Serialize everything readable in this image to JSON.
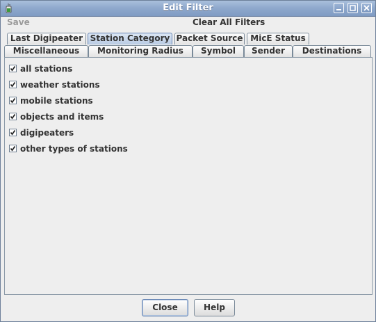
{
  "window": {
    "title": "Edit Filter"
  },
  "toolbar": {
    "save_label": "Save",
    "clear_label": "Clear All Filters"
  },
  "tabs": {
    "row1": [
      "Last Digipeater",
      "Station Category",
      "Packet Source",
      "MicE Status"
    ],
    "row2": [
      "Miscellaneous",
      "Monitoring Radius",
      "Symbol",
      "Sender",
      "Destinations"
    ],
    "selected": "Station Category"
  },
  "station_category": {
    "options": [
      {
        "label": "all stations",
        "checked": true
      },
      {
        "label": "weather stations",
        "checked": true
      },
      {
        "label": "mobile stations",
        "checked": true
      },
      {
        "label": "objects and items",
        "checked": true
      },
      {
        "label": "digipeaters",
        "checked": true
      },
      {
        "label": "other types of stations",
        "checked": true
      }
    ]
  },
  "buttons": {
    "close_label": "Close",
    "help_label": "Help"
  },
  "colors": {
    "titlebar": "#8ea8cc",
    "selected_tab": "#b9cbe4",
    "background": "#eeeeee"
  },
  "icons": {
    "app": "java-cup-icon",
    "minimize": "minimize-icon",
    "maximize": "maximize-icon",
    "close": "close-icon"
  }
}
